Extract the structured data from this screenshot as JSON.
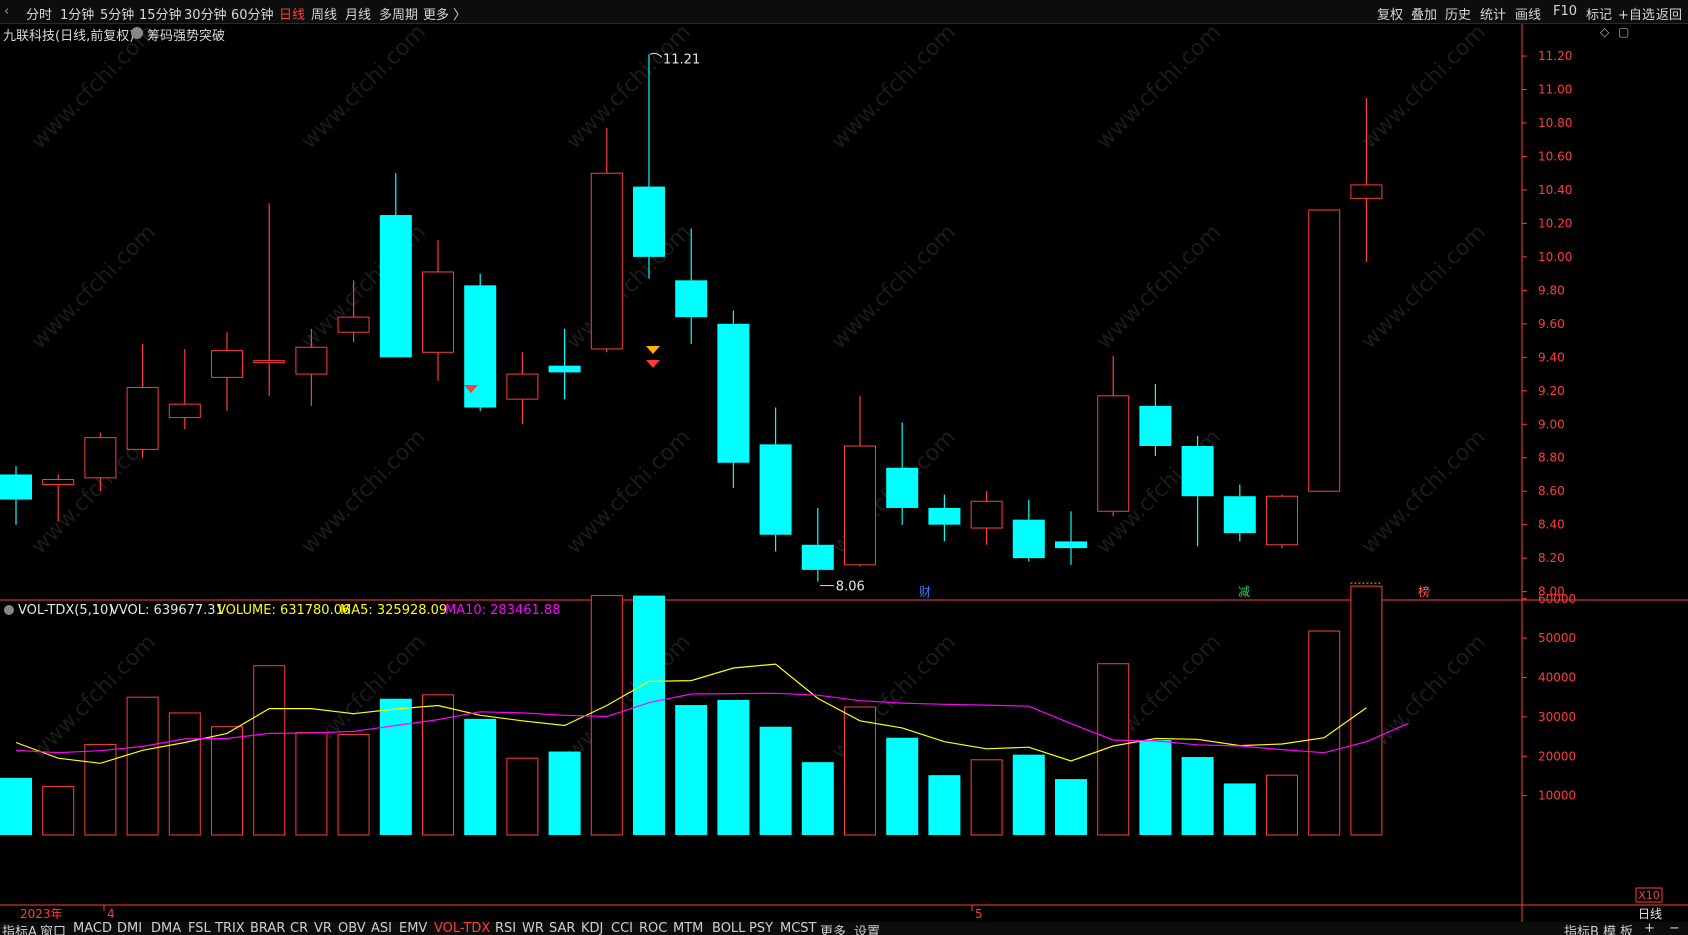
{
  "topbar": {
    "periods": [
      "分时",
      "1分钟",
      "5分钟",
      "15分钟",
      "30分钟",
      "60分钟",
      "日线",
      "周线",
      "月线",
      "多周期",
      "更多 〉"
    ],
    "active": "日线",
    "tools": [
      "复权",
      "叠加",
      "历史",
      "统计",
      "画线",
      "F10",
      "标记",
      "+自选",
      "返回"
    ]
  },
  "header": {
    "stock": "九联科技(日线,前复权)",
    "indicator_label": "筹码强势突破"
  },
  "price_axis": {
    "ticks": [
      "11.20",
      "11.00",
      "10.80",
      "10.60",
      "10.40",
      "10.20",
      "10.00",
      "9.80",
      "9.60",
      "9.40",
      "9.20",
      "9.00",
      "8.80",
      "8.60",
      "8.40",
      "8.20",
      "8.00"
    ]
  },
  "volume_axis": {
    "ticks": [
      "60000",
      "50000",
      "40000",
      "30000",
      "20000",
      "10000"
    ],
    "unit": "X10"
  },
  "annotations": {
    "high": "11.21",
    "low": "8.06",
    "event_labels": [
      "财",
      "减",
      "榜"
    ]
  },
  "volume_panel": {
    "name": "VOL-TDX(5,10)",
    "vvol": "VVOL: 639677.31",
    "volume": "VOLUME: 631780.06",
    "ma5": "MA5: 325928.09",
    "ma10": "MA10: 283461.88"
  },
  "date_axis": {
    "year": "2023年",
    "m4": "4",
    "m5": "5"
  },
  "period_badge": "日线",
  "bottombar": {
    "tabs": [
      "指标A",
      "窗口",
      "MACD",
      "DMI",
      "DMA",
      "FSL",
      "TRIX",
      "BRAR",
      "CR",
      "VR",
      "OBV",
      "ASI",
      "EMV",
      "VOL-TDX",
      "RSI",
      "WR",
      "SAR",
      "KDJ",
      "CCI",
      "ROC",
      "MTM",
      "BOLL",
      "PSY",
      "MCST",
      "更多",
      "设置"
    ],
    "active": "VOL-TDX",
    "right": [
      "指标B",
      "模",
      "板",
      "+",
      "−"
    ]
  },
  "watermark": "www.cfchi.com",
  "colors": {
    "up": "#ff3b3b",
    "down": "#00ffff",
    "ma5": "#ffff00",
    "ma10": "#ff00ff",
    "axis": "#ff3b3b",
    "vvol": "#e6e6e6"
  },
  "chart_data": [
    {
      "type": "candlestick",
      "title": "九联科技(日线,前复权)",
      "ylim": [
        7.95,
        11.26
      ],
      "grid": false,
      "candles": [
        {
          "open": 8.7,
          "high": 8.75,
          "low": 8.4,
          "close": 8.55
        },
        {
          "open": 8.64,
          "high": 8.7,
          "low": 8.42,
          "close": 8.67
        },
        {
          "open": 8.68,
          "high": 8.95,
          "low": 8.6,
          "close": 8.92
        },
        {
          "open": 8.85,
          "high": 9.48,
          "low": 8.8,
          "close": 9.22
        },
        {
          "open": 9.04,
          "high": 9.45,
          "low": 8.97,
          "close": 9.12
        },
        {
          "open": 9.28,
          "high": 9.55,
          "low": 9.08,
          "close": 9.44
        },
        {
          "open": 9.38,
          "high": 10.32,
          "low": 9.17,
          "close": 9.38
        },
        {
          "open": 9.3,
          "high": 9.57,
          "low": 9.11,
          "close": 9.46
        },
        {
          "open": 9.55,
          "high": 9.86,
          "low": 9.49,
          "close": 9.64
        },
        {
          "open": 10.25,
          "high": 10.5,
          "low": 9.4,
          "close": 9.4
        },
        {
          "open": 9.43,
          "high": 10.1,
          "low": 9.26,
          "close": 9.91
        },
        {
          "open": 9.83,
          "high": 9.9,
          "low": 9.08,
          "close": 9.1
        },
        {
          "open": 9.15,
          "high": 9.43,
          "low": 9.0,
          "close": 9.3
        },
        {
          "open": 9.35,
          "high": 9.57,
          "low": 9.15,
          "close": 9.31
        },
        {
          "open": 9.45,
          "high": 10.77,
          "low": 9.43,
          "close": 10.5
        },
        {
          "open": 10.42,
          "high": 11.21,
          "low": 9.87,
          "close": 10.0
        },
        {
          "open": 9.86,
          "high": 10.17,
          "low": 9.48,
          "close": 9.64
        },
        {
          "open": 9.6,
          "high": 9.68,
          "low": 8.62,
          "close": 8.77
        },
        {
          "open": 8.88,
          "high": 9.1,
          "low": 8.24,
          "close": 8.34
        },
        {
          "open": 8.28,
          "high": 8.5,
          "low": 8.06,
          "close": 8.13
        },
        {
          "open": 8.16,
          "high": 9.17,
          "low": 8.15,
          "close": 8.87
        },
        {
          "open": 8.74,
          "high": 9.01,
          "low": 8.4,
          "close": 8.5
        },
        {
          "open": 8.5,
          "high": 8.58,
          "low": 8.3,
          "close": 8.4
        },
        {
          "open": 8.38,
          "high": 8.6,
          "low": 8.28,
          "close": 8.54
        },
        {
          "open": 8.43,
          "high": 8.55,
          "low": 8.18,
          "close": 8.2
        },
        {
          "open": 8.3,
          "high": 8.48,
          "low": 8.16,
          "close": 8.26
        },
        {
          "open": 8.48,
          "high": 9.41,
          "low": 8.45,
          "close": 9.17
        },
        {
          "open": 9.11,
          "high": 9.24,
          "low": 8.81,
          "close": 8.87
        },
        {
          "open": 8.87,
          "high": 8.93,
          "low": 8.27,
          "close": 8.57
        },
        {
          "open": 8.57,
          "high": 8.64,
          "low": 8.3,
          "close": 8.35
        },
        {
          "open": 8.28,
          "high": 8.58,
          "low": 8.26,
          "close": 8.57
        },
        {
          "open": 8.6,
          "high": 10.28,
          "low": 8.6,
          "close": 10.28
        },
        {
          "open": 10.35,
          "high": 10.95,
          "low": 9.97,
          "close": 10.43
        }
      ]
    },
    {
      "type": "bar",
      "title": "VOL-TDX(5,10)",
      "ylim": [
        0,
        64000
      ],
      "volumes": [
        14500,
        12300,
        23000,
        35000,
        31000,
        27500,
        43000,
        26000,
        25500,
        34600,
        35600,
        29500,
        19500,
        21200,
        60800,
        60800,
        33000,
        34300,
        27500,
        18500,
        32500,
        24700,
        15200,
        19100,
        20400,
        14200,
        43500,
        24100,
        19800,
        13100,
        15200,
        51800,
        63200
      ],
      "series": [
        {
          "name": "MA5",
          "values": [
            23500,
            19500,
            18200,
            21500,
            23500,
            25800,
            32100,
            32100,
            30800,
            32000,
            32900,
            30400,
            29000,
            27800,
            32900,
            39000,
            39200,
            42400,
            43400,
            34700,
            29000,
            27200,
            23700,
            21900,
            22300,
            18800,
            22600,
            24500,
            24300,
            22700,
            23100,
            24700,
            32300
          ]
        },
        {
          "name": "MA10",
          "values": [
            21500,
            20900,
            21400,
            22500,
            24400,
            24500,
            25800,
            25900,
            26300,
            27800,
            29300,
            31300,
            31000,
            30400,
            30100,
            33600,
            35800,
            35900,
            36000,
            35500,
            34100,
            33500,
            33200,
            33000,
            32700,
            28300,
            24100,
            23900,
            22900,
            22600,
            21700,
            20900,
            23700,
            28400
          ]
        }
      ]
    }
  ]
}
